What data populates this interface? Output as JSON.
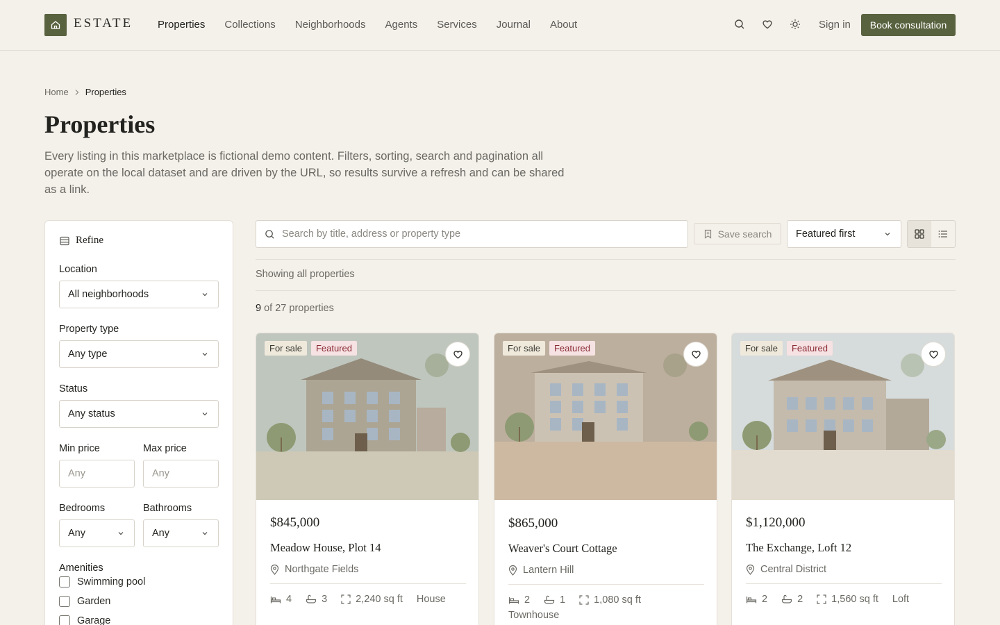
{
  "brand": {
    "name": "ESTATE"
  },
  "nav": [
    "Properties",
    "Collections",
    "Neighborhoods",
    "Agents",
    "Services",
    "Journal",
    "About"
  ],
  "header": {
    "signin": "Sign in",
    "cta": "Book consultation"
  },
  "breadcrumb": {
    "home": "Home",
    "current": "Properties"
  },
  "page": {
    "title": "Properties",
    "description": "Every listing in this marketplace is fictional demo content. Filters, sorting, search and pagination all operate on the local dataset and are driven by the URL, so results survive a refresh and can be shared as a link."
  },
  "filters": {
    "heading": "Refine",
    "location": {
      "label": "Location",
      "value": "All neighborhoods"
    },
    "type": {
      "label": "Property type",
      "value": "Any type"
    },
    "status": {
      "label": "Status",
      "value": "Any status"
    },
    "min_price": {
      "label": "Min price",
      "placeholder": "Any"
    },
    "max_price": {
      "label": "Max price",
      "placeholder": "Any"
    },
    "bedrooms": {
      "label": "Bedrooms",
      "value": "Any"
    },
    "bathrooms": {
      "label": "Bathrooms",
      "value": "Any"
    },
    "amenities": {
      "label": "Amenities",
      "items": [
        "Swimming pool",
        "Garden",
        "Garage"
      ]
    }
  },
  "toolbar": {
    "search_placeholder": "Search by title, address or property type",
    "save_search": "Save search",
    "sort": "Featured first",
    "showing": "Showing all properties",
    "count_shown": "9",
    "count_rest": "of 27 properties"
  },
  "colors": {
    "accent": "#59623f",
    "featured_badge": "#8a2a34",
    "background": "#f4f0ea"
  },
  "listings": [
    {
      "status": "For sale",
      "tag": "Featured",
      "price": "$845,000",
      "title": "Meadow House, Plot 14",
      "location": "Northgate Fields",
      "beds": "4",
      "baths": "3",
      "area": "2,240 sq ft",
      "type": "House"
    },
    {
      "status": "For sale",
      "tag": "Featured",
      "price": "$865,000",
      "title": "Weaver's Court Cottage",
      "location": "Lantern Hill",
      "beds": "2",
      "baths": "1",
      "area": "1,080 sq ft",
      "type": "Townhouse"
    },
    {
      "status": "For sale",
      "tag": "Featured",
      "price": "$1,120,000",
      "title": "The Exchange, Loft 12",
      "location": "Central District",
      "beds": "2",
      "baths": "2",
      "area": "1,560 sq ft",
      "type": "Loft"
    }
  ]
}
